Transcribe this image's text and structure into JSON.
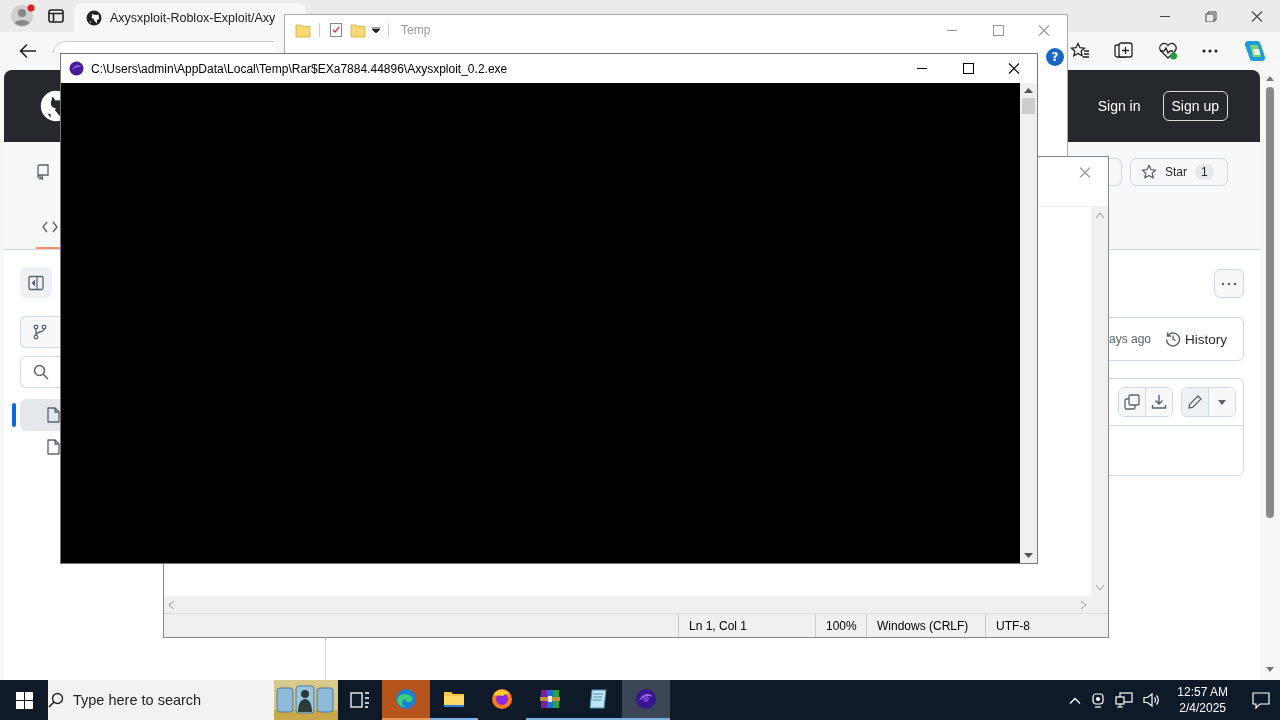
{
  "browser": {
    "tab": {
      "title": "Axysxploit-Roblox-Exploit/Axy",
      "selected": true
    },
    "header": {
      "links": [
        {
          "label": "Sign in",
          "kind": "text"
        },
        {
          "label": "Sign up",
          "kind": "outlined"
        }
      ]
    },
    "star": {
      "label": "Star",
      "count": "1"
    },
    "code_tab": {
      "selected": true
    },
    "files": [
      {
        "selected": true
      },
      {
        "selected": false
      }
    ],
    "commit": {
      "age": "ays ago",
      "history": "History"
    }
  },
  "explorer_window": {
    "title": "Temp",
    "active": false,
    "help": "?"
  },
  "notepad_window": {
    "status_bar": [
      "Ln 1, Col 1",
      "100%",
      "Windows (CRLF)",
      "UTF-8"
    ]
  },
  "console_window": {
    "title": "C:\\Users\\admin\\AppData\\Local\\Temp\\Rar$EXa7884.44896\\Axysxploit_0.2.exe",
    "active": true
  },
  "taskbar": {
    "search": {
      "placeholder": "Type here to search"
    },
    "apps": [
      {
        "kind": "edge",
        "open": true,
        "flashing": true,
        "selected": false
      },
      {
        "kind": "explorer",
        "open": true,
        "flashing": false,
        "selected": false
      },
      {
        "kind": "firefox",
        "open": false,
        "flashing": false,
        "selected": false
      },
      {
        "kind": "winrar",
        "open": true,
        "flashing": false,
        "selected": false
      },
      {
        "kind": "notepad",
        "open": true,
        "flashing": false,
        "selected": false
      },
      {
        "kind": "console",
        "open": true,
        "flashing": false,
        "selected": true
      }
    ],
    "clock": {
      "time": "12:57 AM",
      "date": "2/4/2025"
    }
  }
}
